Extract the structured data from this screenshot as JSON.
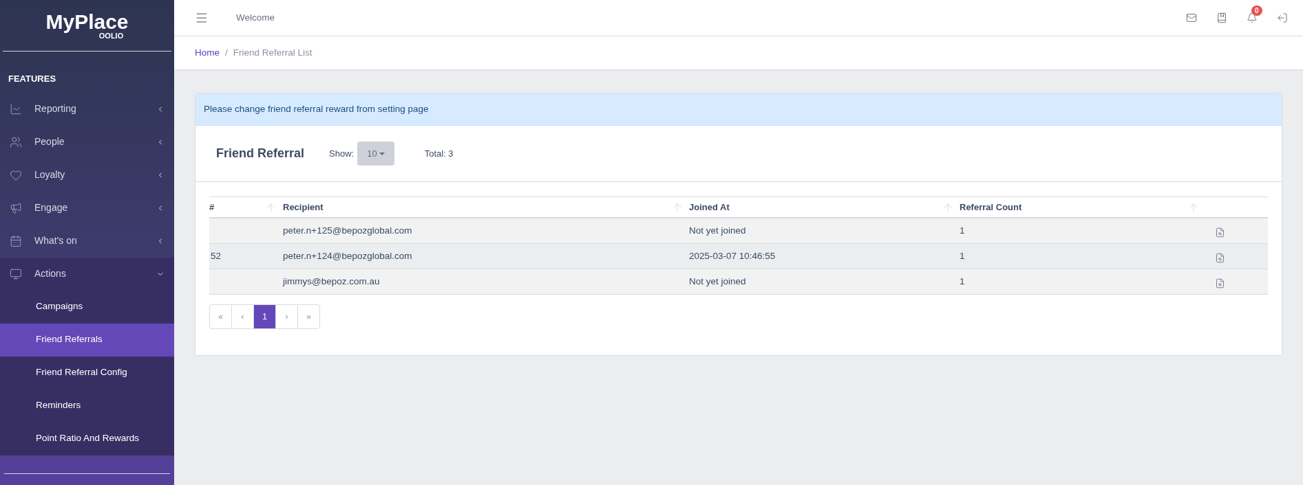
{
  "sidebar": {
    "logo": {
      "title": "MyPlace",
      "subtitle": "OOLIO"
    },
    "section": "FEATURES",
    "items": [
      {
        "label": "Reporting",
        "expanded": false
      },
      {
        "label": "People",
        "expanded": false
      },
      {
        "label": "Loyalty",
        "expanded": false
      },
      {
        "label": "Engage",
        "expanded": false
      },
      {
        "label": "What's on",
        "expanded": false
      },
      {
        "label": "Actions",
        "expanded": true,
        "children": [
          {
            "label": "Campaigns",
            "selected": false
          },
          {
            "label": "Friend Referrals",
            "selected": true
          },
          {
            "label": "Friend Referral Config",
            "selected": false
          },
          {
            "label": "Reminders",
            "selected": false
          },
          {
            "label": "Point Ratio And Rewards",
            "selected": false
          }
        ]
      }
    ]
  },
  "topbar": {
    "title": "Welcome",
    "notification_count": "0"
  },
  "breadcrumb": [
    {
      "label": "Home",
      "kind": "link"
    },
    {
      "label": "Friend Referral List",
      "kind": "current",
      "separator": "/"
    }
  ],
  "alert": "Please change friend referral reward from setting page",
  "card": {
    "title": "Friend Referral",
    "show_label": "Show:",
    "page_size": "10",
    "total": "Total: 3"
  },
  "table": {
    "columns": [
      "#",
      "Recipient",
      "Joined At",
      "Referral Count",
      ""
    ],
    "rows": [
      [
        "",
        "peter.n+125@bepozglobal.com",
        "Not yet joined",
        "1"
      ],
      [
        "52",
        "peter.n+124@bepozglobal.com",
        "2025-03-07 10:46:55",
        "1"
      ],
      [
        "",
        "jimmys@bepoz.com.au",
        "Not yet joined",
        "1"
      ]
    ]
  },
  "pagination": [
    {
      "label": "«",
      "selected": false
    },
    {
      "label": "‹",
      "selected": false
    },
    {
      "label": "1",
      "selected": true
    },
    {
      "label": "›",
      "selected": false
    },
    {
      "label": "»",
      "selected": false
    }
  ]
}
